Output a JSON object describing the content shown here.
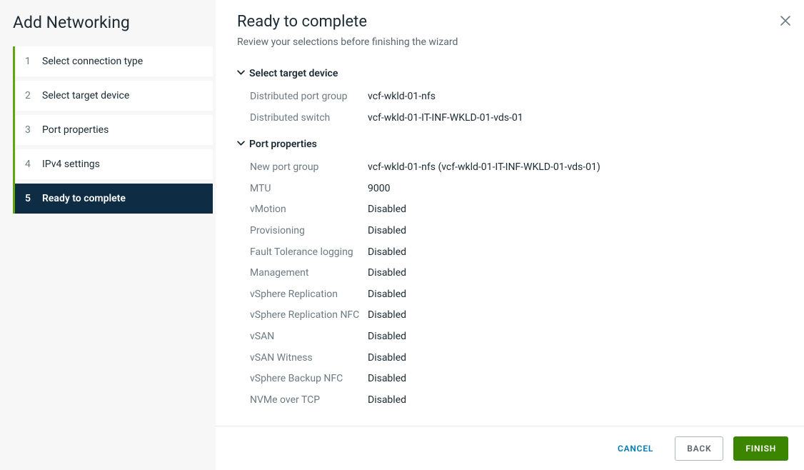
{
  "wizard": {
    "title": "Add Networking",
    "steps": [
      {
        "num": "1",
        "label": "Select connection type"
      },
      {
        "num": "2",
        "label": "Select target device"
      },
      {
        "num": "3",
        "label": "Port properties"
      },
      {
        "num": "4",
        "label": "IPv4 settings"
      },
      {
        "num": "5",
        "label": "Ready to complete"
      }
    ]
  },
  "page": {
    "title": "Ready to complete",
    "subtitle": "Review your selections before finishing the wizard"
  },
  "sections": {
    "targetDevice": {
      "heading": "Select target device",
      "rows": [
        {
          "k": "Distributed port group",
          "v": "vcf-wkld-01-nfs"
        },
        {
          "k": "Distributed switch",
          "v": "vcf-wkld-01-IT-INF-WKLD-01-vds-01"
        }
      ]
    },
    "portProperties": {
      "heading": "Port properties",
      "rows": [
        {
          "k": "New port group",
          "v": "vcf-wkld-01-nfs (vcf-wkld-01-IT-INF-WKLD-01-vds-01)"
        },
        {
          "k": "MTU",
          "v": "9000"
        },
        {
          "k": "vMotion",
          "v": "Disabled"
        },
        {
          "k": "Provisioning",
          "v": "Disabled"
        },
        {
          "k": "Fault Tolerance logging",
          "v": "Disabled"
        },
        {
          "k": "Management",
          "v": "Disabled"
        },
        {
          "k": "vSphere Replication",
          "v": "Disabled"
        },
        {
          "k": "vSphere Replication NFC",
          "v": "Disabled"
        },
        {
          "k": "vSAN",
          "v": "Disabled"
        },
        {
          "k": "vSAN Witness",
          "v": "Disabled"
        },
        {
          "k": "vSphere Backup NFC",
          "v": "Disabled"
        },
        {
          "k": "NVMe over TCP",
          "v": "Disabled"
        }
      ]
    }
  },
  "footer": {
    "cancel": "CANCEL",
    "back": "BACK",
    "finish": "FINISH"
  }
}
